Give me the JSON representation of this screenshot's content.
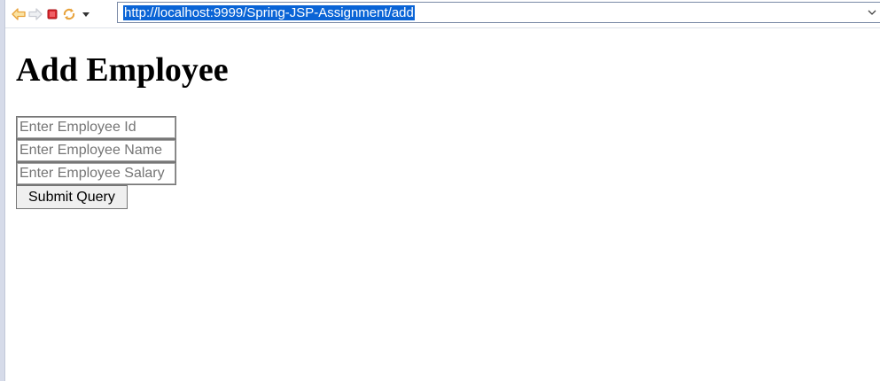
{
  "browser": {
    "address_url": "http://localhost:9999/Spring-JSP-Assignment/add",
    "icons": {
      "back": "back-arrow-icon",
      "forward": "forward-arrow-icon",
      "stop": "stop-icon",
      "refresh": "refresh-icon",
      "menu": "dropdown-caret-icon",
      "address_dropdown": "chevron-down-icon"
    },
    "colors": {
      "back_arrow": "#e8a23a",
      "forward_arrow": "#c9ccd3",
      "stop": "#d9262c",
      "url_highlight": "#0a64d6"
    }
  },
  "page": {
    "title": "Add Employee",
    "form": {
      "employee_id_placeholder": "Enter Employee Id",
      "employee_name_placeholder": "Enter Employee Name",
      "employee_salary_placeholder": "Enter Employee Salary",
      "submit_label": "Submit Query"
    }
  }
}
